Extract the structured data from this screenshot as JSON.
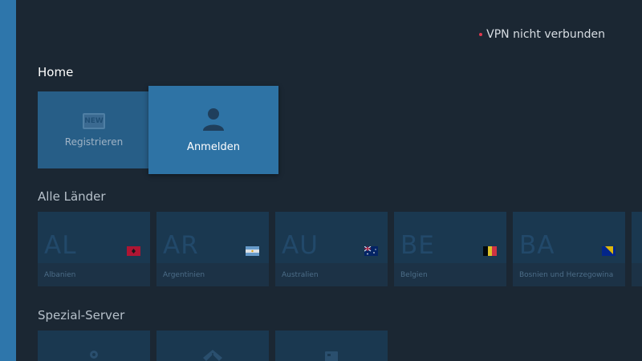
{
  "status": {
    "vpn_text": "VPN nicht verbunden",
    "indicator_color": "#e0394f"
  },
  "home": {
    "title": "Home",
    "register": {
      "badge": "NEW",
      "label": "Registrieren"
    },
    "login": {
      "label": "Anmelden",
      "icon": "user-icon"
    }
  },
  "countries": {
    "title": "Alle Länder",
    "items": [
      {
        "code": "AL",
        "name": "Albanien",
        "flag": "flag-albania"
      },
      {
        "code": "AR",
        "name": "Argentinien",
        "flag": "flag-argentina"
      },
      {
        "code": "AU",
        "name": "Australien",
        "flag": "flag-australia"
      },
      {
        "code": "BE",
        "name": "Belgien",
        "flag": "flag-belgium"
      },
      {
        "code": "BA",
        "name": "Bosnien und Herzegowina",
        "flag": "flag-bosnia"
      }
    ]
  },
  "special": {
    "title": "Spezial-Server",
    "items": [
      {
        "icon": "location-pin-icon"
      },
      {
        "icon": "shield-icon"
      },
      {
        "icon": "server-icon"
      }
    ]
  },
  "colors": {
    "background": "#1b2733",
    "accent": "#2e76ab",
    "focus_tile": "#2e73a5"
  }
}
